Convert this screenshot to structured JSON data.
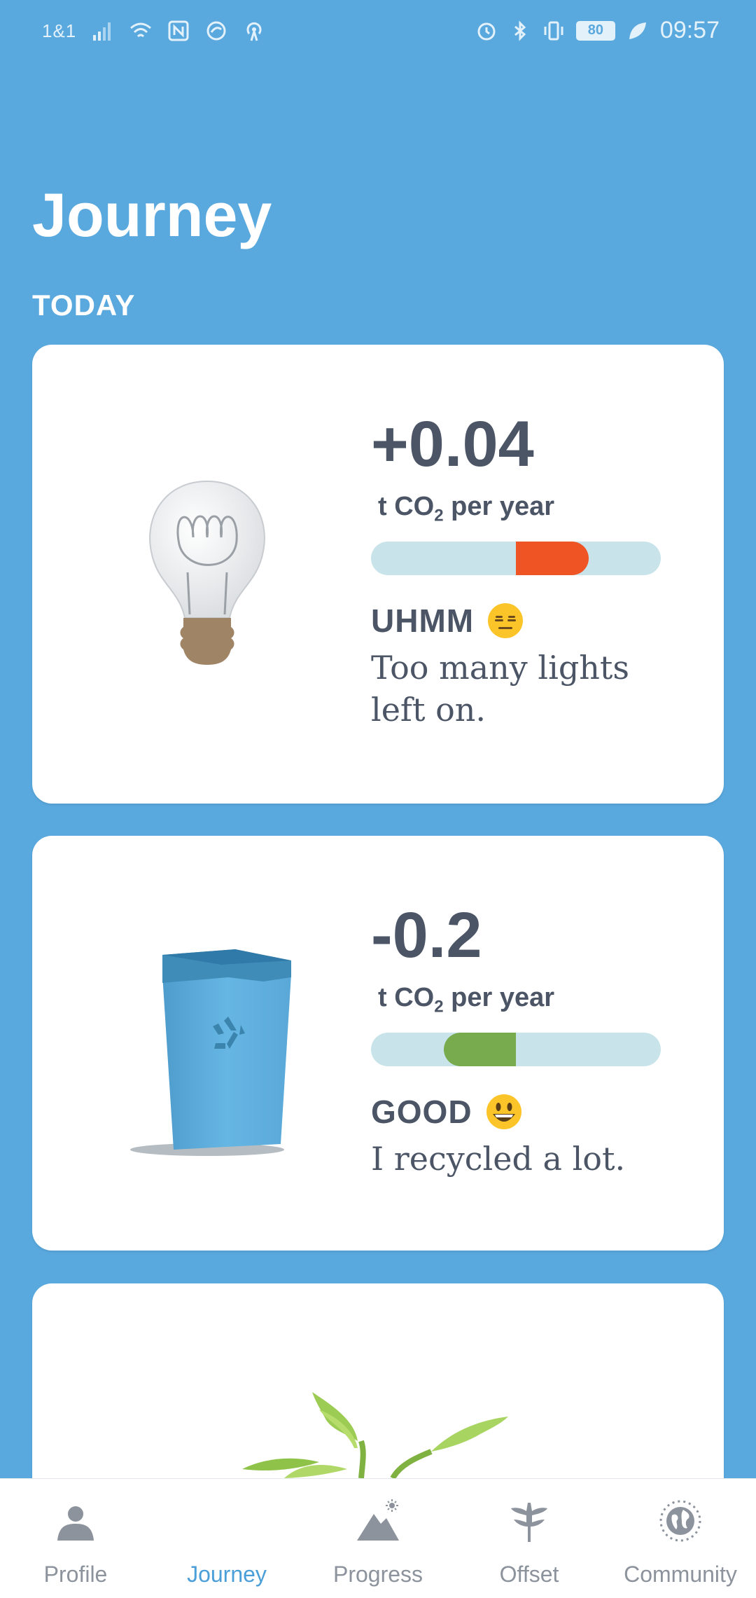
{
  "status_bar": {
    "carrier": "1&1",
    "battery": "80",
    "time": "09:57"
  },
  "header": {
    "title": "Journey",
    "section": "TODAY"
  },
  "cards": [
    {
      "delta": "+0.04",
      "unit_prefix": "t CO",
      "unit_sub": "2",
      "unit_suffix": " per year",
      "gauge": {
        "side": "increase",
        "fraction": 0.25,
        "color": "#ef5524"
      },
      "rating": "UHMM",
      "emoji": "expressionless-face",
      "description": "Too many lights left on."
    },
    {
      "delta": "-0.2",
      "unit_prefix": "t CO",
      "unit_sub": "2",
      "unit_suffix": " per year",
      "gauge": {
        "side": "decrease",
        "fraction": 0.25,
        "color": "#78ab4e"
      },
      "rating": "GOOD",
      "emoji": "grinning-face",
      "description": "I recycled a lot."
    }
  ],
  "nav": {
    "items": [
      {
        "label": "Profile",
        "icon": "person-icon",
        "active": false
      },
      {
        "label": "Journey",
        "icon": "journey-icon",
        "active": true
      },
      {
        "label": "Progress",
        "icon": "mountain-icon",
        "active": false
      },
      {
        "label": "Offset",
        "icon": "tree-icon",
        "active": false
      },
      {
        "label": "Community",
        "icon": "globe-icon",
        "active": false
      }
    ]
  },
  "colors": {
    "background": "#59a8de",
    "text_dark": "#4b5565",
    "gauge_track": "#c8e4ea",
    "nav_active": "#4a9fd8",
    "nav_inactive": "#8c939c"
  }
}
